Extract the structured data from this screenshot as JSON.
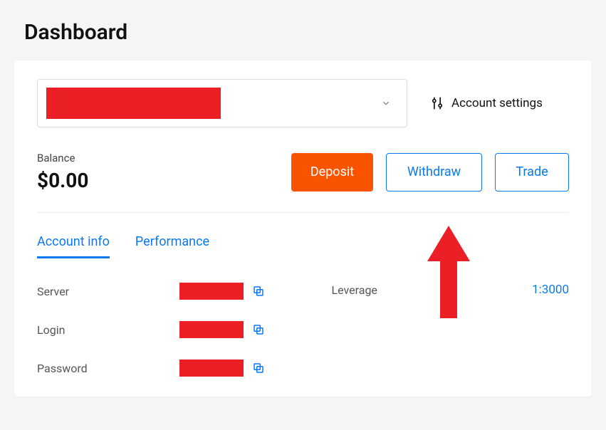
{
  "page": {
    "title": "Dashboard"
  },
  "account_select": {
    "selected_value_redacted": true
  },
  "header_right": {
    "settings_label": "Account settings"
  },
  "balance": {
    "label": "Balance",
    "value": "$0.00"
  },
  "actions": {
    "deposit": "Deposit",
    "withdraw": "Withdraw",
    "trade": "Trade"
  },
  "tabs": {
    "account_info": "Account info",
    "performance": "Performance",
    "active": "account_info"
  },
  "account_info": {
    "server_label": "Server",
    "server_value_redacted": true,
    "login_label": "Login",
    "login_value_redacted": true,
    "password_label": "Password",
    "password_value_redacted": true,
    "leverage_label": "Leverage",
    "leverage_value": "1:3000"
  },
  "colors": {
    "primary_orange": "#fa5300",
    "link_blue": "#0a7af3",
    "redaction_red": "#eb2027"
  },
  "annotations": {
    "arrow_points_to": "withdraw-button"
  }
}
